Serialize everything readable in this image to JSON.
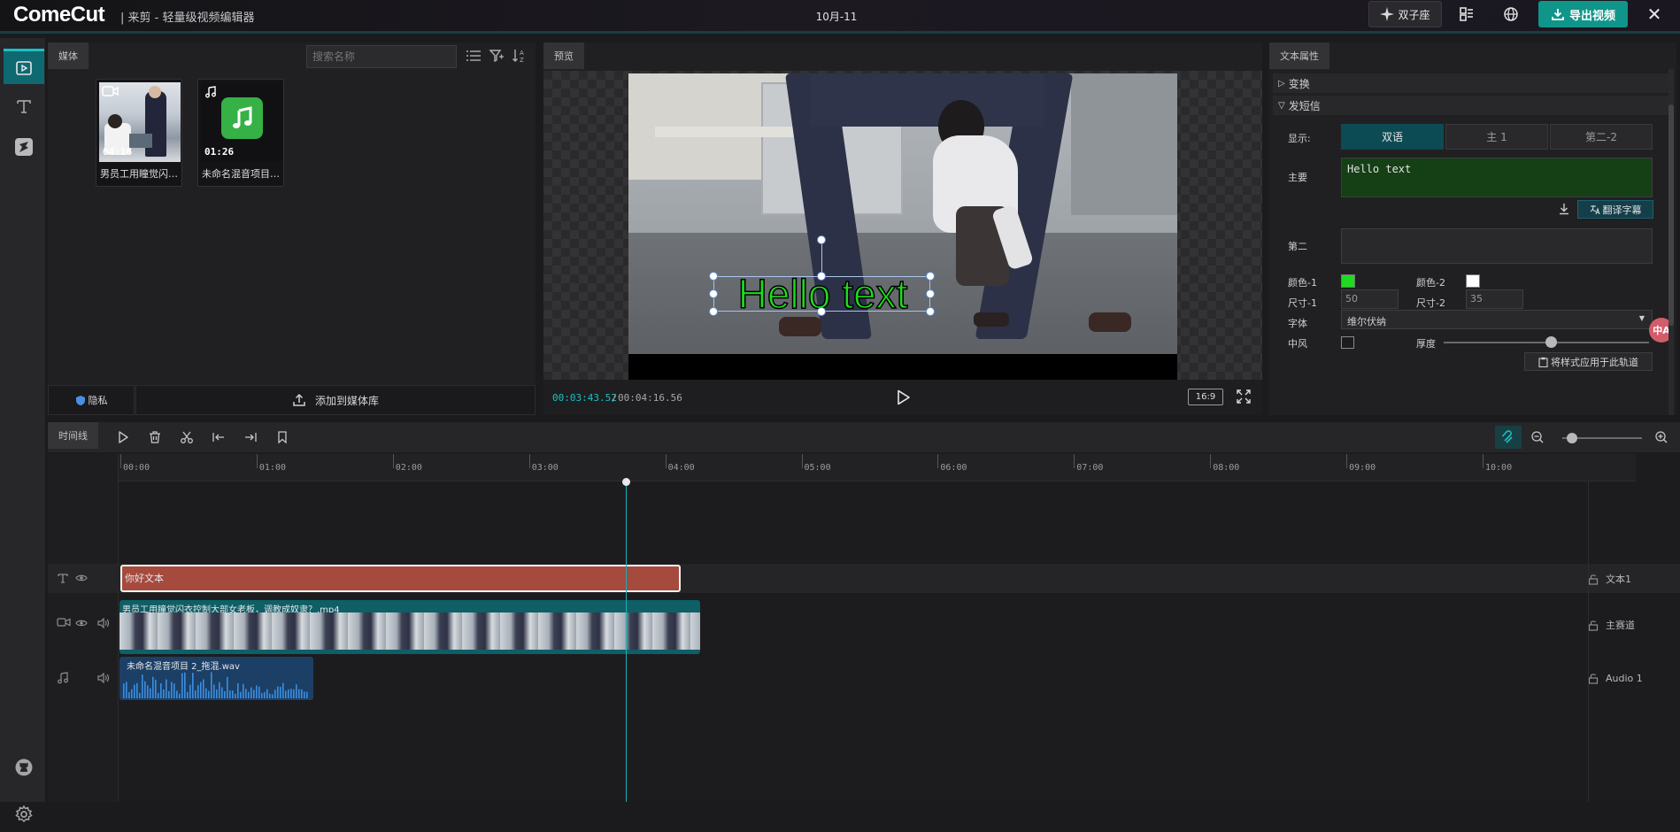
{
  "app": {
    "logo": "ComeCut",
    "subtitle": "| 来剪 - 轻量级视频编辑器",
    "date": "10月-11",
    "gemini_label": "双子座",
    "export_label": "导出视频",
    "close_glyph": "✕"
  },
  "media": {
    "tab": "媒体",
    "search_placeholder": "搜索名称",
    "items": [
      {
        "name": "男员工用瞳觉闪衣控制大部女老板，调教成奴隶？.mp4",
        "duration": "04:16",
        "kind": "video"
      },
      {
        "name": "未命名混音项目 2_拖混.wav",
        "duration": "01:26",
        "kind": "audio"
      }
    ],
    "privacy_label": "隐私",
    "add_label": "添加到媒体库"
  },
  "preview": {
    "tab": "预览",
    "overlay_text": "Hello text",
    "time_current": "00:03:43.52",
    "time_sep": "/",
    "time_total": "00:04:16.56",
    "ratio": "16:9"
  },
  "props": {
    "tab": "文本属性",
    "section_transform": "变换",
    "section_subtitle": "发短信",
    "display_label": "显示:",
    "display_options": [
      "双语",
      "主 1",
      "第二-2"
    ],
    "display_selected": 0,
    "primary_label": "主要",
    "primary_text": "Hello text",
    "translate_label": "翻译字幕",
    "secondary_label": "第二",
    "secondary_text": "",
    "color1_label": "颜色-1",
    "color2_label": "颜色-2",
    "color1": "#1ddc1d",
    "color2": "#ffffff",
    "size1_label": "尺寸-1",
    "size2_label": "尺寸-2",
    "size1": "50",
    "size2": "35",
    "font_label": "字体",
    "font_value": "维尔伏纳",
    "stroke_label": "中风",
    "thickness_label": "厚度",
    "thickness_level": 0.52,
    "apply_label": "将样式应用于此轨道"
  },
  "timeline": {
    "tab": "时间线",
    "ticks": [
      "00:00",
      "01:00",
      "02:00",
      "03:00",
      "04:00",
      "05:00",
      "06:00",
      "07:00",
      "08:00",
      "09:00",
      "10:00"
    ],
    "zoom_level": 0.05,
    "tracks": {
      "text": {
        "clip_label": "你好文本",
        "name": "文本1"
      },
      "video": {
        "clip_label": "男员工用瞳觉闪衣控制大部女老板，调教成奴隶？.mp4",
        "name": "主赛道"
      },
      "audio": {
        "clip_label": "未命名混音项目 2_拖混.wav",
        "name": "Audio 1"
      }
    }
  },
  "colors": {
    "accent": "#1ac0c4",
    "export": "#10958a",
    "text_clip": "#a64a3d",
    "video_clip": "#0e5f66",
    "audio_clip": "#1c3f66"
  }
}
